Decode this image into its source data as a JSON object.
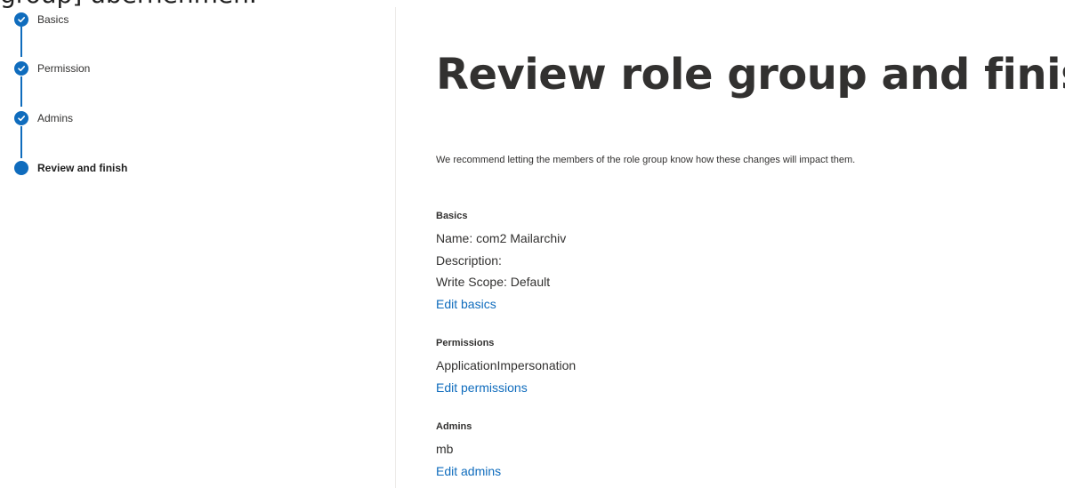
{
  "header_overflow_text": "group] übernehmen.",
  "stepper": {
    "steps": [
      {
        "label": "Basics",
        "status": "completed"
      },
      {
        "label": "Permission",
        "status": "completed"
      },
      {
        "label": "Admins",
        "status": "completed"
      },
      {
        "label": "Review and finish",
        "status": "current"
      }
    ]
  },
  "main": {
    "title": "Review role group and finish",
    "intro": "We recommend letting the members of the role group know how these changes will impact them.",
    "basics": {
      "heading": "Basics",
      "name": "Name: com2 Mailarchiv",
      "description": "Description:",
      "write_scope": "Write Scope: Default",
      "edit_label": "Edit basics"
    },
    "permissions": {
      "heading": "Permissions",
      "items": [
        "ApplicationImpersonation"
      ],
      "edit_label": "Edit permissions"
    },
    "admins": {
      "heading": "Admins",
      "items": [
        "mb"
      ],
      "edit_label": "Edit admins"
    }
  },
  "colors": {
    "accent": "#0f6cbd",
    "text": "#323130",
    "divider": "#edebe9"
  }
}
